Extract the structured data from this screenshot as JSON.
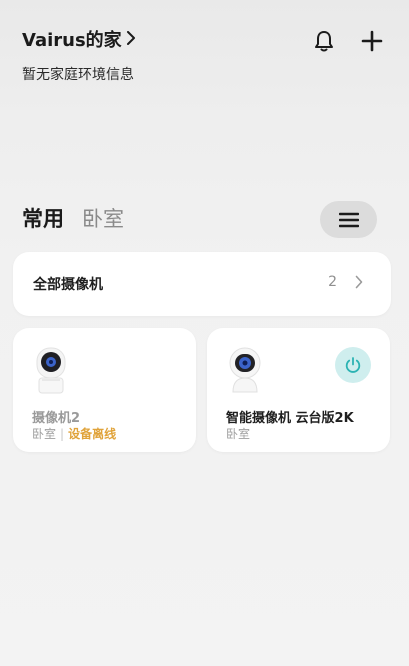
{
  "header": {
    "home_name": "Vairus的家",
    "env_info": "暂无家庭环境信息"
  },
  "tabs": [
    {
      "label": "常用",
      "active": true
    },
    {
      "label": "卧室",
      "active": false
    }
  ],
  "all_cameras": {
    "label": "全部摄像机",
    "count": "2"
  },
  "devices": [
    {
      "name": "摄像机2",
      "room": "卧室",
      "status": "设备离线"
    },
    {
      "name": "智能摄像机 云台版2K",
      "room": "卧室"
    }
  ],
  "colors": {
    "offline_status": "#e0a33a",
    "power_bg": "#cfeeee",
    "power_icon": "#2bb3b3",
    "camera_lens": "#3b63c9"
  },
  "icons": {
    "bell": "bell-icon",
    "add": "plus-icon",
    "menu": "menu-icon",
    "power": "power-icon"
  }
}
